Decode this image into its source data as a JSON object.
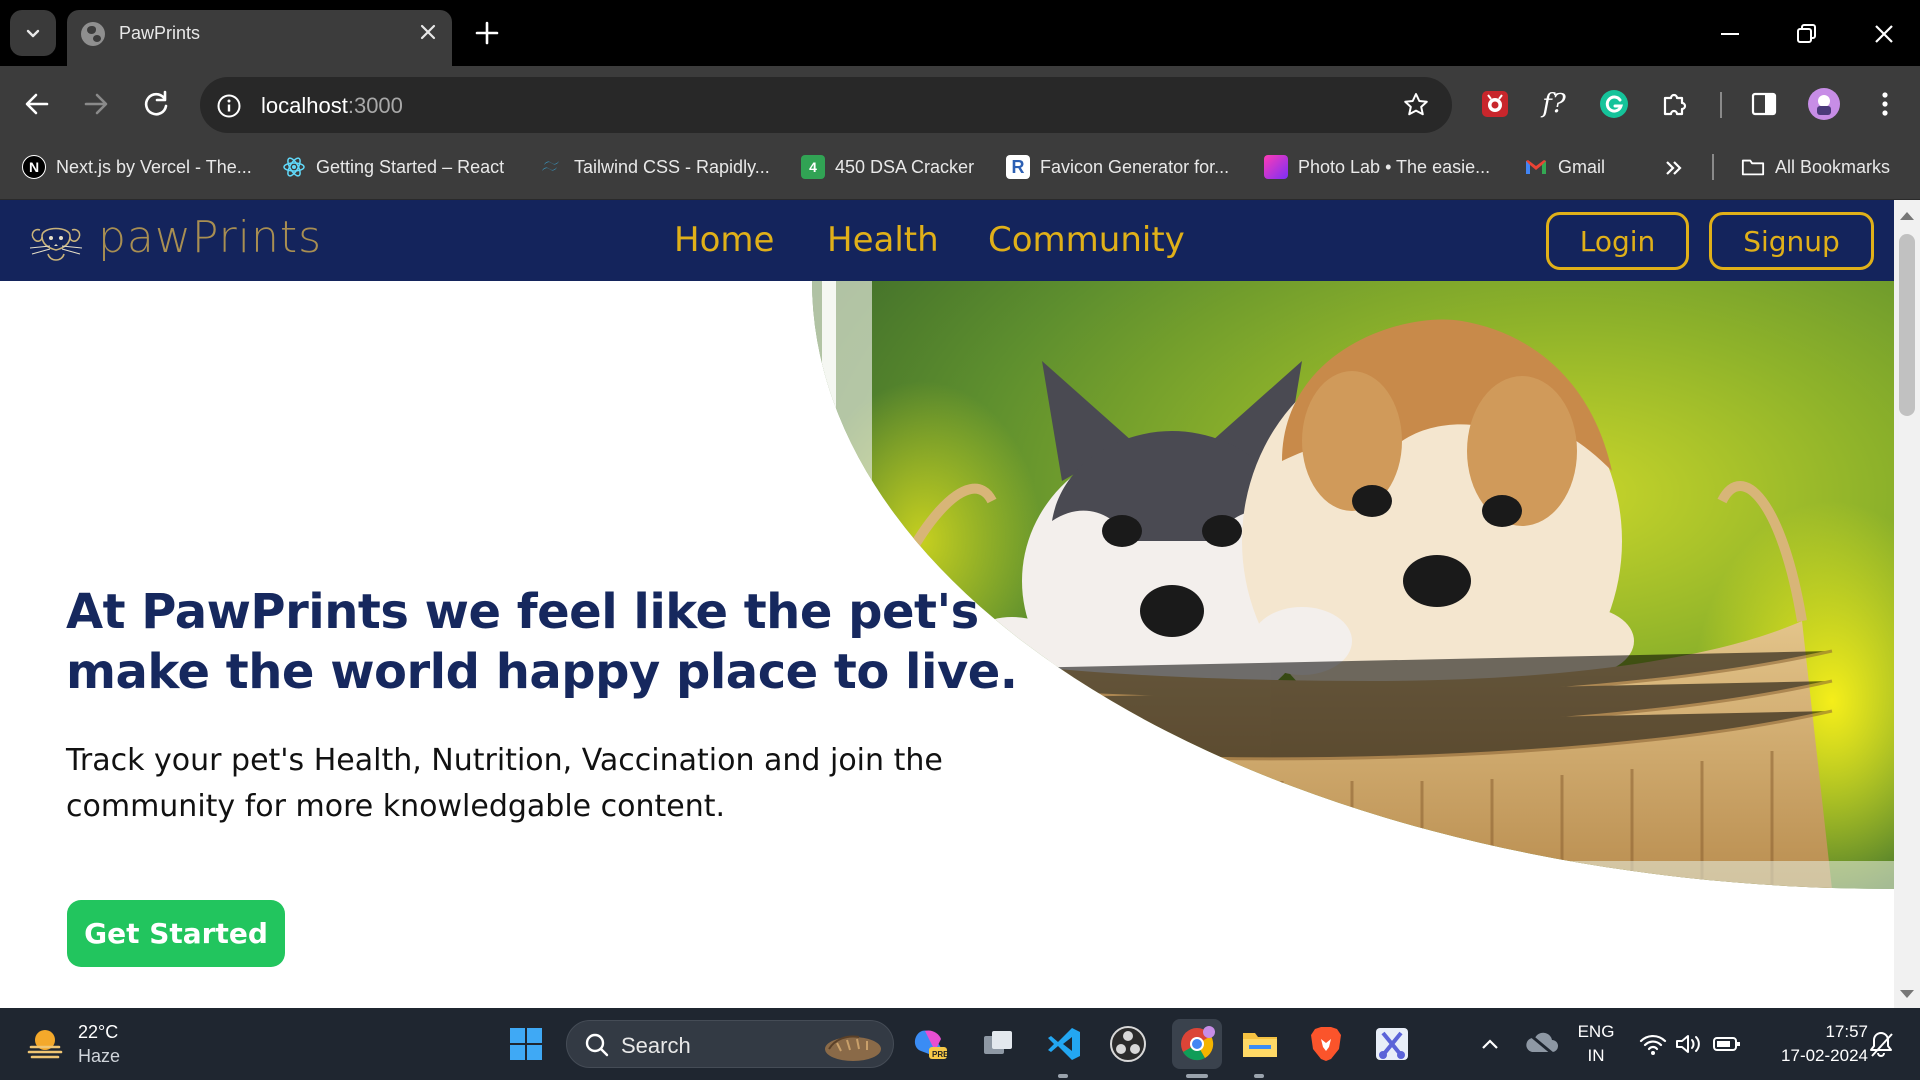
{
  "browser": {
    "tab": {
      "title": "PawPrints"
    },
    "address": {
      "host": "localhost",
      "port": ":3000"
    },
    "bookmarks": [
      {
        "label": "Next.js by Vercel - The...",
        "icon": "nextjs-icon"
      },
      {
        "label": "Getting Started – React",
        "icon": "react-icon"
      },
      {
        "label": "Tailwind CSS - Rapidly...",
        "icon": "tailwind-icon"
      },
      {
        "label": "450 DSA Cracker",
        "icon": "dsa-icon"
      },
      {
        "label": "Favicon Generator for...",
        "icon": "favicon-generator-icon"
      },
      {
        "label": "Photo Lab • The easie...",
        "icon": "photolab-icon"
      },
      {
        "label": "Gmail",
        "icon": "gmail-icon"
      }
    ],
    "all_bookmarks": "All Bookmarks",
    "extension_text": "f?"
  },
  "site": {
    "brand": "pawPrints",
    "nav": [
      "Home",
      "Health",
      "Community"
    ],
    "login": "Login",
    "signup": "Signup",
    "headline": "At PawPrints we feel like the pet's make the world happy place to live.",
    "subtext": "Track your pet's Health, Nutrition, Vaccination and join the community for more knowledgable content.",
    "cta": "Get Started",
    "colors": {
      "navbar": "#14245c",
      "accent": "#e0b019",
      "cta": "#22c55e",
      "headline": "#16285e"
    }
  },
  "taskbar": {
    "weather": {
      "temp": "22°C",
      "condition": "Haze"
    },
    "search": "Search",
    "lang": [
      "ENG",
      "IN"
    ],
    "time": "17:57",
    "date": "17-02-2024"
  }
}
